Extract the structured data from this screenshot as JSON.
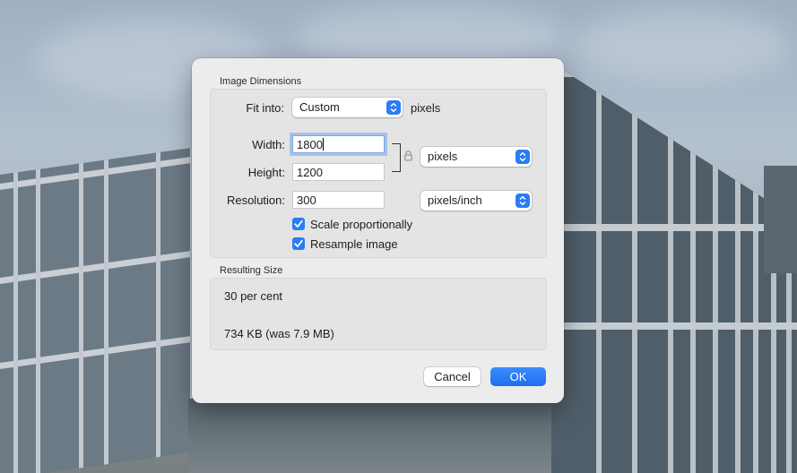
{
  "dialog": {
    "image_dimensions": {
      "title": "Image Dimensions",
      "fit_into": {
        "label": "Fit into:",
        "value": "Custom",
        "unit": "pixels"
      },
      "width": {
        "label": "Width:",
        "value": "1800"
      },
      "height": {
        "label": "Height:",
        "value": "1200"
      },
      "dimension_unit": "pixels",
      "resolution": {
        "label": "Resolution:",
        "value": "300",
        "unit": "pixels/inch"
      },
      "scale_proportionally": {
        "label": "Scale proportionally",
        "checked": true
      },
      "resample_image": {
        "label": "Resample image",
        "checked": true
      }
    },
    "resulting_size": {
      "title": "Resulting Size",
      "percent": "30 per cent",
      "file_size": "734 KB (was 7.9 MB)"
    },
    "buttons": {
      "cancel": "Cancel",
      "ok": "OK"
    }
  },
  "colors": {
    "accent": "#2a7cf7",
    "dialog_bg": "#ececec",
    "group_bg": "#e4e4e4"
  },
  "icons": [
    "popup-arrows-icon",
    "lock-icon",
    "checkmark-icon"
  ]
}
